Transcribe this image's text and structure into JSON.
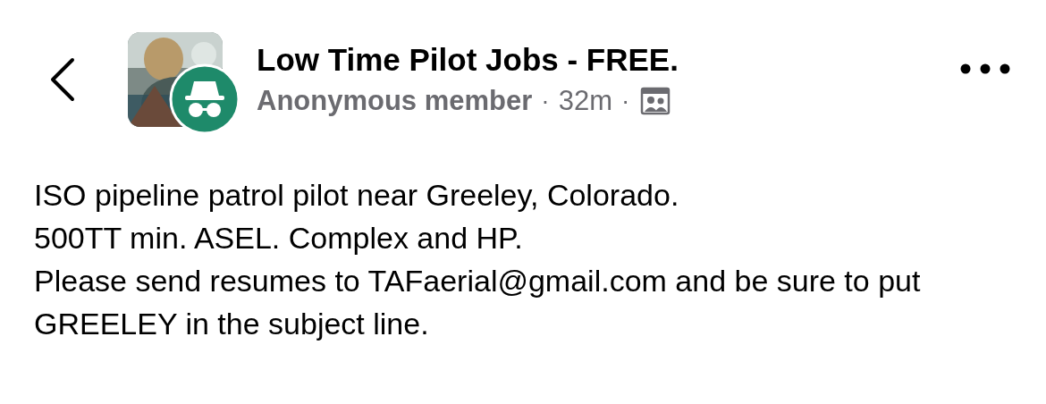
{
  "header": {
    "group_name": "Low Time Pilot Jobs - FREE.",
    "author": "Anonymous member",
    "separator_1": "·",
    "time": "32m",
    "separator_2": "·"
  },
  "post": {
    "paragraphs": [
      "ISO pipeline patrol pilot near Greeley, Colorado.",
      "500TT min. ASEL. Complex and HP.",
      "Please send resumes to TAFaerial@gmail.com and be sure to put GREELEY in the subject line."
    ]
  }
}
